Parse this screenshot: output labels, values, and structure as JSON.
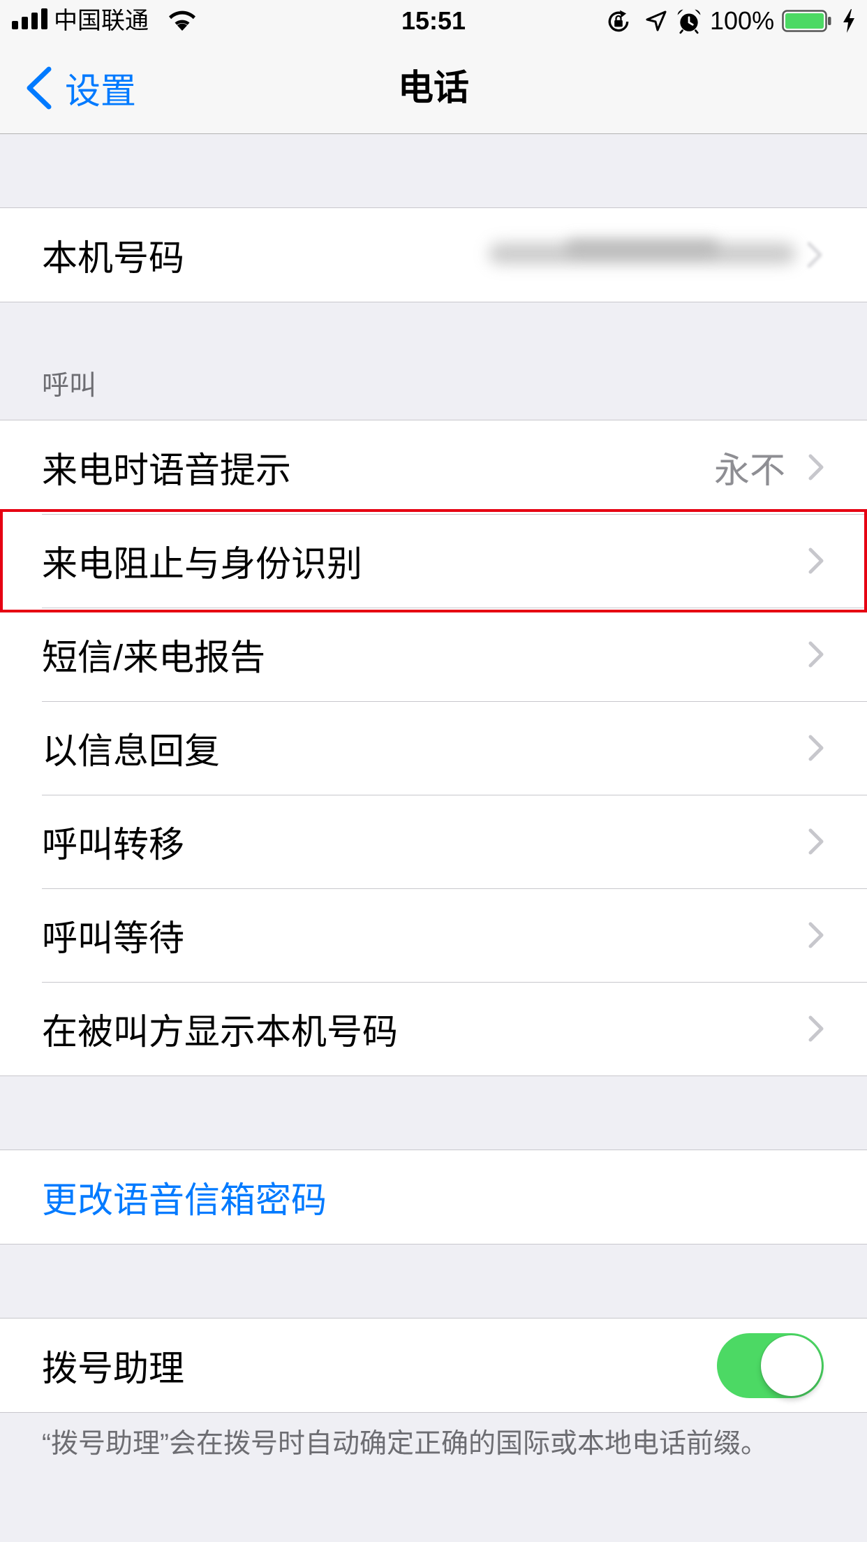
{
  "status_bar": {
    "carrier": "中国联通",
    "time": "15:51",
    "battery_text": "100%",
    "battery_level": 1.0,
    "charging": true,
    "icons": [
      "signal-bars-icon",
      "wifi-icon",
      "rotation-lock-icon",
      "location-arrow-icon",
      "alarm-icon",
      "battery-icon",
      "charging-bolt-icon"
    ]
  },
  "nav": {
    "back_label": "设置",
    "title": "电话"
  },
  "my_number_section": {
    "rows": [
      {
        "label": "本机号码",
        "value_blurred": true,
        "chevron": true
      }
    ]
  },
  "calls_section": {
    "header": "呼叫",
    "rows": [
      {
        "label": "来电时语音提示",
        "detail": "永不",
        "chevron": true
      },
      {
        "label": "来电阻止与身份识别",
        "chevron": true,
        "highlighted": true
      },
      {
        "label": "短信/来电报告",
        "chevron": true
      },
      {
        "label": "以信息回复",
        "chevron": true
      },
      {
        "label": "呼叫转移",
        "chevron": true
      },
      {
        "label": "呼叫等待",
        "chevron": true
      },
      {
        "label": "在被叫方显示本机号码",
        "chevron": true
      }
    ]
  },
  "voicemail_section": {
    "rows": [
      {
        "label": "更改语音信箱密码"
      }
    ]
  },
  "dial_assist_section": {
    "rows": [
      {
        "label": "拨号助理",
        "toggle_on": true
      }
    ],
    "footer": "“拨号助理”会在拨号时自动确定正确的国际或本地电话前缀。"
  },
  "colors": {
    "accent": "#007aff",
    "switch_on": "#4cd964",
    "highlight": "#e60012",
    "detail_text": "#8e8e93",
    "separator": "#c8c7cc",
    "chevron": "#c7c7cc",
    "section_text": "#6d6d72",
    "battery_fill": "#4cd964"
  }
}
